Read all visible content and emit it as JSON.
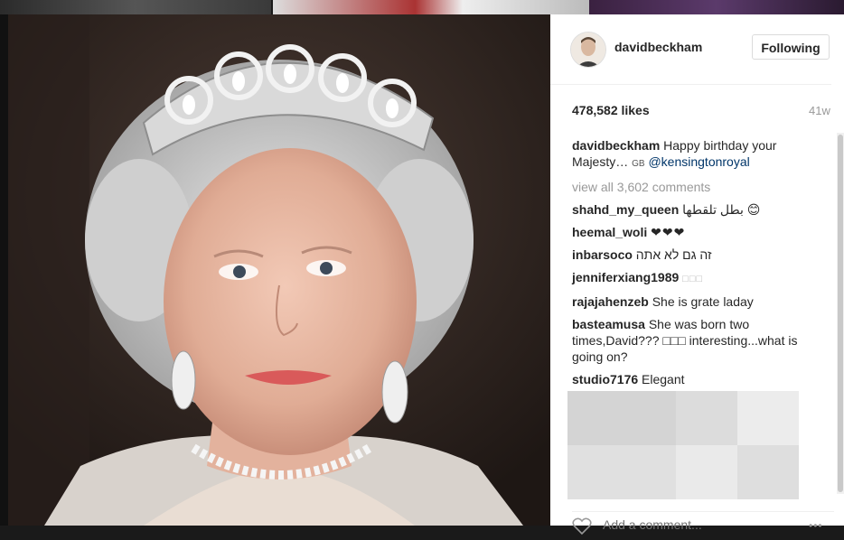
{
  "post": {
    "username": "davidbeckham",
    "follow_label": "Following",
    "likes": "478,582 likes",
    "age": "41w",
    "caption_user": "davidbeckham",
    "caption_text": "Happy birthday your Majesty…",
    "caption_flag": "GB",
    "caption_tag": "@kensingtonroyal",
    "view_all": "view all 3,602 comments"
  },
  "comments": [
    {
      "user": "shahd_my_queen",
      "text": "بطل تلقطها 😊"
    },
    {
      "user": "heemal_woli",
      "text": "❤❤❤"
    },
    {
      "user": "inbarsoco",
      "text": "זה גם לא אתה"
    },
    {
      "user": "jenniferxiang1989",
      "text": "□□□"
    },
    {
      "user": "rajajahenzeb",
      "text": "She is grate laday"
    },
    {
      "user": "basteamusa",
      "text": "She was born two times,David??? □□□ interesting...what is going on?"
    },
    {
      "user": "studio7176",
      "text": "Elegant"
    }
  ],
  "footer": {
    "add_comment_placeholder": "Add a comment...",
    "more_label": "•••"
  },
  "icons": {
    "like": "heart-icon",
    "more": "more-options-icon"
  },
  "colors": {
    "link": "#003569",
    "muted": "#999999",
    "text": "#262626"
  }
}
